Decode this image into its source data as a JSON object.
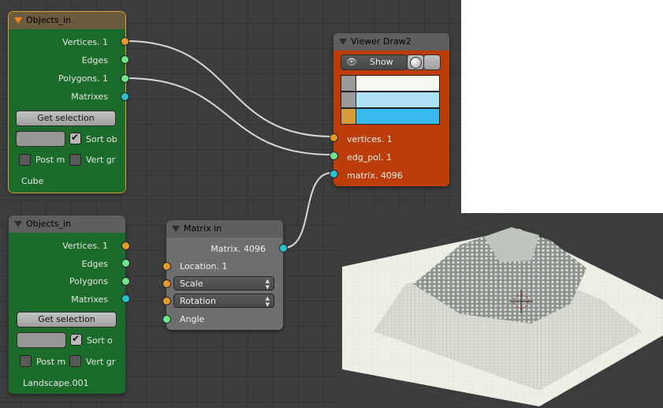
{
  "colors": {
    "green_node": "#1b6b2a",
    "orange_node": "#bd3d08",
    "gray_node": "#6e6e6e",
    "socket_vertices": "#e69a2c",
    "socket_edges": "#6ee68a",
    "socket_matrix": "#28c2cf"
  },
  "node_objects1": {
    "title": "Objects_in",
    "outputs": [
      "Vertices. 1",
      "Edges",
      "Polygons. 1",
      "Matrixes"
    ],
    "get_selection": "Get selection",
    "sort_label": "Sort ob",
    "post_label": "Post m",
    "vert_label": "Vert gr",
    "object_name": "Cube"
  },
  "node_objects2": {
    "title": "Objects_in",
    "outputs": [
      "Vertices. 1",
      "Edges",
      "Polygons",
      "Matrixes"
    ],
    "get_selection": "Get selection",
    "sort_label": "Sort o",
    "post_label": "Post m",
    "vert_label": "Vert gr",
    "object_name": "Landscape.001"
  },
  "node_matrix": {
    "title": "Matrix in",
    "output": "Matrix. 4096",
    "inputs": {
      "location": "Location. 1",
      "scale": "Scale",
      "rotation": "Rotation",
      "angle": "Angle"
    }
  },
  "node_viewer": {
    "title": "Viewer Draw2",
    "show_label": "Show",
    "swatches": [
      "#f7f7f2",
      "#aee0f5",
      "#39b8ec"
    ],
    "inputs": [
      "vertices. 1",
      "edg_pol. 1",
      "matrix. 4096"
    ]
  },
  "icons": [
    "eye-icon",
    "sphere-icon",
    "cube-icon",
    "collapse-triangle-icon",
    "cursor-crosshair-icon"
  ]
}
